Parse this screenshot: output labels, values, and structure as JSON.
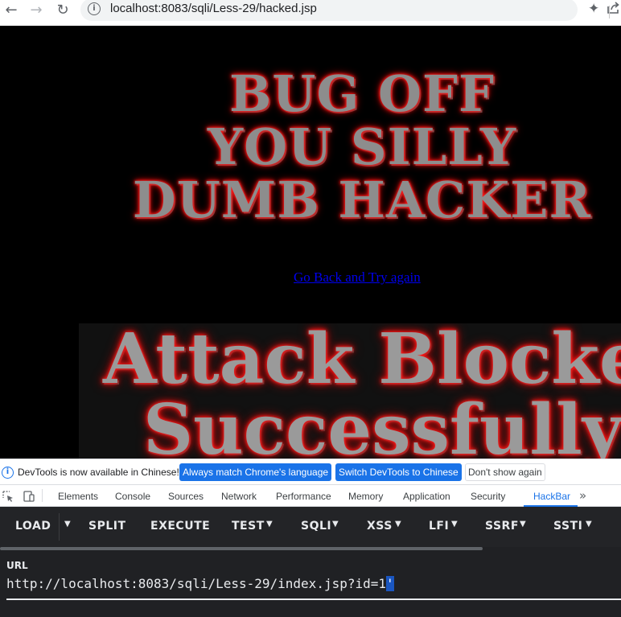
{
  "browser": {
    "url": "localhost:8083/sqli/Less-29/hacked.jsp"
  },
  "page": {
    "banner_lines": [
      "BUG OFF",
      "YOU SILLY",
      "DUMB HACKER"
    ],
    "go_back_link": "Go Back and Try again",
    "blocked_line1": "Attack Blocked",
    "blocked_line2": "Successfully"
  },
  "notice": {
    "text": "DevTools is now available in Chinese!",
    "btn_always": "Always match Chrome's language",
    "btn_switch": "Switch DevTools to Chinese",
    "btn_dont": "Don't show again"
  },
  "devtools": {
    "tabs": [
      "Elements",
      "Console",
      "Sources",
      "Network",
      "Performance",
      "Memory",
      "Application",
      "Security",
      "HackBar"
    ],
    "active_tab": "HackBar"
  },
  "hackbar": {
    "buttons": [
      "LOAD",
      "SPLIT",
      "EXECUTE",
      "TEST",
      "SQLI",
      "XSS",
      "LFI",
      "SSRF",
      "SSTI"
    ],
    "url_label": "URL",
    "url_value_main": "http://localhost:8083/sqli/Less-29/index.jsp?id=1",
    "url_value_selected": "'"
  },
  "icons": {
    "back": "arrow-left-icon",
    "forward": "arrow-right-icon",
    "reload": "reload-icon",
    "info": "info-icon",
    "share": "share-icon",
    "star": "star-icon",
    "extensions": "puzzle-icon",
    "inspect": "inspect-element-icon",
    "device": "device-toolbar-icon",
    "more": "chevron-double-right-icon"
  },
  "colors": {
    "link": "#0000ee",
    "accent": "#1a73e8",
    "glow": "#ff1a1a"
  }
}
